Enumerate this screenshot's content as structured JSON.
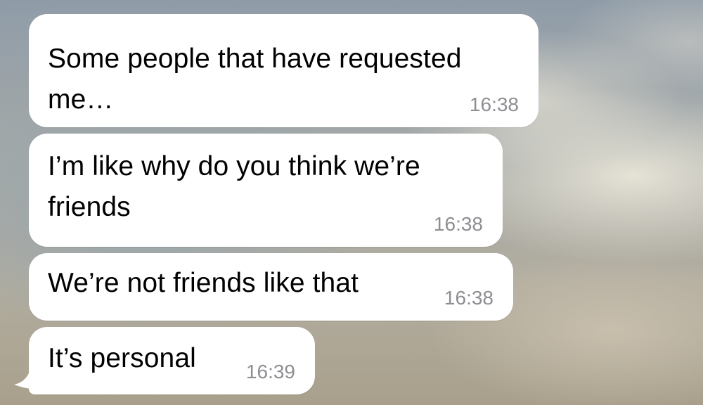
{
  "conversation": {
    "messages": [
      {
        "text": "Some people that have requested\nme…",
        "time": "16:38"
      },
      {
        "text": "I’m like why do you think we’re\nfriends",
        "time": "16:38"
      },
      {
        "text": "We’re not friends like that",
        "time": "16:38"
      },
      {
        "text": "It’s personal",
        "time": "16:39"
      }
    ]
  },
  "colors": {
    "bubble": "#ffffff",
    "timestamp": "#8e8e93",
    "text": "#000000"
  }
}
